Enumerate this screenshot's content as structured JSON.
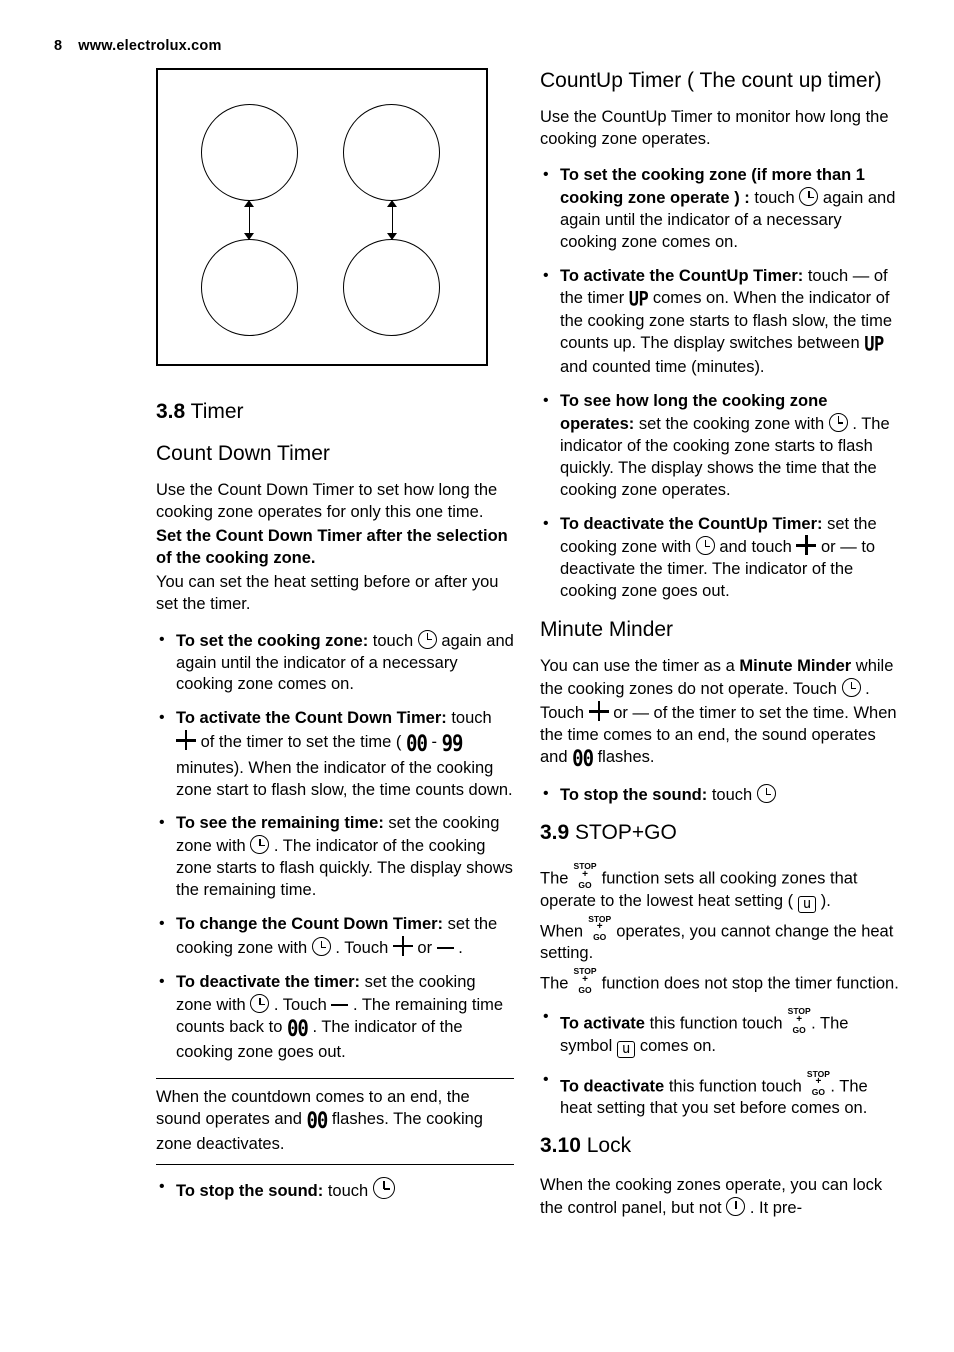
{
  "header": {
    "page_number": "8",
    "site": "www.electrolux.com"
  },
  "figure": {
    "name": "hob-zone-diagram",
    "caption": ""
  },
  "left": {
    "section_number": "3.8",
    "section_title": "Timer",
    "sub1_title": "Count Down Timer",
    "p1": "Use the Count Down Timer to set how long the cooking zone operates for only this one time.",
    "p2_bold": "Set the Count Down Timer after the selection of the cooking zone.",
    "p3": "You can set the heat setting before or after you set the timer.",
    "bullets": [
      {
        "lead": "To set the cooking zone:",
        "rest_a": " touch ",
        "rest_b": " again and again until the indicator of a necessary cooking zone comes on."
      },
      {
        "lead": "To activate the Count Down Timer:",
        "rest_a": " touch ",
        "rest_b": " of the timer to set the time ( ",
        "digits_from": "00",
        "dash": "-",
        "digits_to": "99",
        "rest_c": " minutes). When the indicator of the cooking zone start to flash slow, the time counts down."
      },
      {
        "lead": "To see the remaining time:",
        "rest_a": " set the cooking zone with ",
        "rest_b": ". The indicator of the cooking zone starts to flash quickly. The display shows the remaining time."
      },
      {
        "lead": "To change the Count Down Timer:",
        "rest_a": " set the cooking zone with ",
        "rest_b": ". Touch ",
        "rest_c": " or ",
        "rest_d": " ."
      },
      {
        "lead": "To deactivate the timer:",
        "rest_a": " set the cooking zone with ",
        "rest_b": ". Touch ",
        "rest_c": " . The remaining time counts back to ",
        "digits": "00",
        "rest_d": " . The indicator of the cooking zone goes out."
      }
    ],
    "note_a": "When the countdown comes to an end, the sound operates and ",
    "note_digits": "00",
    "note_b": " flashes. The cooking zone deactivates.",
    "stop_sound_lead": "To stop the sound:",
    "stop_sound_rest": " touch "
  },
  "right": {
    "sub1_title": "CountUp Timer ( The count up timer)",
    "p1": "Use the CountUp Timer to monitor how long the cooking zone operates.",
    "bullets": [
      {
        "lead": "To set the cooking zone (if more than 1 cooking zone operate ) :",
        "rest_a": " touch ",
        "rest_b": " again and again until the indicator of a necessary cooking zone comes on."
      },
      {
        "lead": "To activate the CountUp Timer:",
        "rest_a": " touch ",
        "minus": "—",
        "rest_b": " of the timer ",
        "up1": "UP",
        "rest_c": " comes on. When the indicator of the cooking zone starts to flash slow, the time counts up. The display switches between ",
        "up2": "UP",
        "rest_d": " and counted time (minutes)."
      },
      {
        "lead": "To see how long the cooking zone operates:",
        "rest_a": " set the cooking zone with ",
        "rest_b": ". The indicator of the cooking zone starts to flash quickly. The display shows the time that the cooking zone operates."
      },
      {
        "lead": "To deactivate the CountUp Timer:",
        "rest_a": " set the cooking zone with ",
        "rest_b": " and touch ",
        "rest_c": " or ",
        "minus": "—",
        "rest_d": " to deactivate the timer. The indicator of the cooking zone goes out."
      }
    ],
    "sub2_title": "Minute Minder",
    "mm_p_a": "You can use the timer as a ",
    "mm_p_bold": "Minute Minder",
    "mm_p_b": " while the cooking zones do not operate. Touch ",
    "mm_p_c": ". Touch ",
    "mm_p_d": " or ",
    "mm_minus": "—",
    "mm_p_e": " of the timer to set the time. When the time comes to an end, the sound operates and ",
    "mm_digits": "00",
    "mm_p_f": " flashes.",
    "mm_stop_lead": "To stop the sound:",
    "mm_stop_rest": " touch ",
    "sec39_number": "3.9",
    "sec39_title": "STOP+GO",
    "sg_p1_a": "The ",
    "sg_p1_b": " function sets all cooking zones that operate to the lowest heat setting ( ",
    "sg_symbol_u": "u",
    "sg_p1_c": " ).",
    "sg_p2_a": "When ",
    "sg_p2_b": " operates, you cannot change the heat setting.",
    "sg_p3_a": "The ",
    "sg_p3_b": " function does not stop the timer function.",
    "sg_bullets": [
      {
        "lead": "To activate",
        "rest_a": " this function touch ",
        "rest_b": ". The symbol ",
        "symbol_u": "u",
        "rest_c": " comes on."
      },
      {
        "lead": "To deactivate",
        "rest_a": " this function touch ",
        "rest_b": ". The heat setting that you set before comes on."
      }
    ],
    "sec310_number": "3.10",
    "sec310_title": "Lock",
    "lock_p_a": "When the cooking zones operate, you can lock the control panel, but not ",
    "lock_p_b": ". It pre-"
  },
  "icons": {
    "timer_clock": "clock-icon",
    "onoff": "onoff-icon",
    "plus": "plus-icon",
    "minus": "minus-icon",
    "stopgo": "stop-go-icon"
  },
  "stopgo_label": {
    "top": "STOP",
    "mid": "+",
    "bottom": "GO"
  }
}
